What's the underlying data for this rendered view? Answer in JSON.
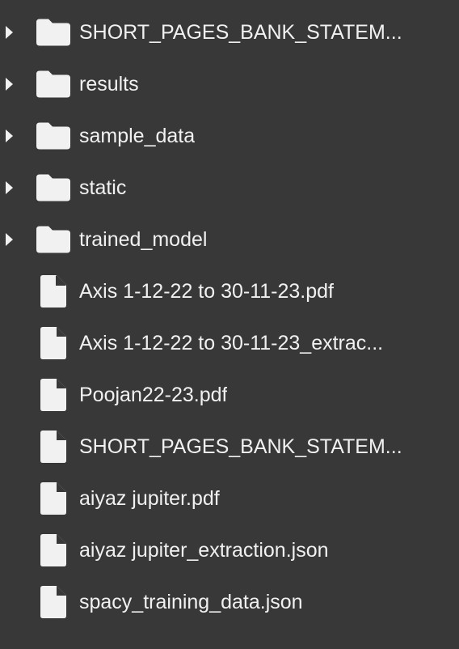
{
  "colors": {
    "background": "#383838",
    "text": "#f1f1f1",
    "icon": "#f1f1f1"
  },
  "file_tree": {
    "items": [
      {
        "type": "folder",
        "icon": "folder-icon",
        "name": "SHORT_PAGES_BANK_STATEM..."
      },
      {
        "type": "folder",
        "icon": "folder-icon",
        "name": "results"
      },
      {
        "type": "folder",
        "icon": "folder-icon",
        "name": "sample_data"
      },
      {
        "type": "folder",
        "icon": "folder-icon",
        "name": "static"
      },
      {
        "type": "folder",
        "icon": "folder-icon",
        "name": "trained_model"
      },
      {
        "type": "file",
        "icon": "file-icon",
        "name": "Axis 1-12-22 to 30-11-23.pdf"
      },
      {
        "type": "file",
        "icon": "file-icon",
        "name": "Axis 1-12-22 to 30-11-23_extrac..."
      },
      {
        "type": "file",
        "icon": "file-icon",
        "name": "Poojan22-23.pdf"
      },
      {
        "type": "file",
        "icon": "file-icon",
        "name": "SHORT_PAGES_BANK_STATEM..."
      },
      {
        "type": "file",
        "icon": "file-icon",
        "name": "aiyaz jupiter.pdf"
      },
      {
        "type": "file",
        "icon": "file-icon",
        "name": "aiyaz jupiter_extraction.json"
      },
      {
        "type": "file",
        "icon": "file-icon",
        "name": "spacy_training_data.json"
      }
    ]
  }
}
